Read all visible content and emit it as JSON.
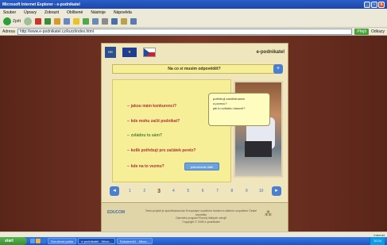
{
  "window": {
    "title": "Microsoft Internet Explorer - e-podnikatel",
    "controls": [
      "_",
      "▫",
      "x"
    ]
  },
  "menu": [
    "Soubor",
    "Úpravy",
    "Zobrazit",
    "Oblíbené",
    "Nástroje",
    "Nápověda"
  ],
  "toolbar": {
    "back_label": "Zpět"
  },
  "address": {
    "label": "Adresa",
    "value": "http://www.e-podnikatel.cz/kurz/index.html",
    "go_label": "Přejít",
    "links_label": "Odkazy"
  },
  "app": {
    "brand": "e-podnikatel",
    "logo_text": "RR",
    "eu_text": "★",
    "question": "Na co si musim odpovědět?",
    "question_nav": "+",
    "options": [
      {
        "label": "jakou mám konkurenci?",
        "state": "normal"
      },
      {
        "label": "kde mohu začít podnikat?",
        "state": "normal"
      },
      {
        "label": "zvládnu to sám?",
        "state": "active"
      },
      {
        "label": "kolik potřebuji pro začátek peněz?",
        "state": "normal"
      },
      {
        "label": "kde na to vezmu?",
        "state": "normal"
      }
    ],
    "tooltip": [
      "potřebuji zaměstnance",
      "a pomoc?",
      "jak to zvládnu časově?"
    ],
    "next_button": "pokračovat dále",
    "pager": {
      "prev": "◂",
      "next": "▸",
      "pages": [
        "1",
        "2",
        "3",
        "4",
        "5",
        "6",
        "7",
        "8",
        "9",
        "10"
      ],
      "current": "3"
    },
    "footer": {
      "logo": "EDUCOM",
      "lines": [
        "Tento projekt je spolufinancován Evropským sociálním fondem a státním rozpočtem České republiky",
        "Operační program Rozvoj lidských zdrojů",
        "Copyright © 2005 e-podnikatel"
      ],
      "deco": "⁂"
    }
  },
  "status": {
    "left": "",
    "zone": "Internet"
  },
  "taskbar": {
    "start": "start",
    "tasks": [
      "Doručená pošta",
      "e-podnikatel - Micro...",
      "Dokument1 - Micro..."
    ],
    "active_task": 1,
    "clock": "10:24"
  },
  "colors": {
    "background": "#6a2f22",
    "panel": "#efe6bd",
    "accent": "#4a7fd0",
    "option_text": "#aa3333",
    "active_option": "#4a7e34"
  }
}
